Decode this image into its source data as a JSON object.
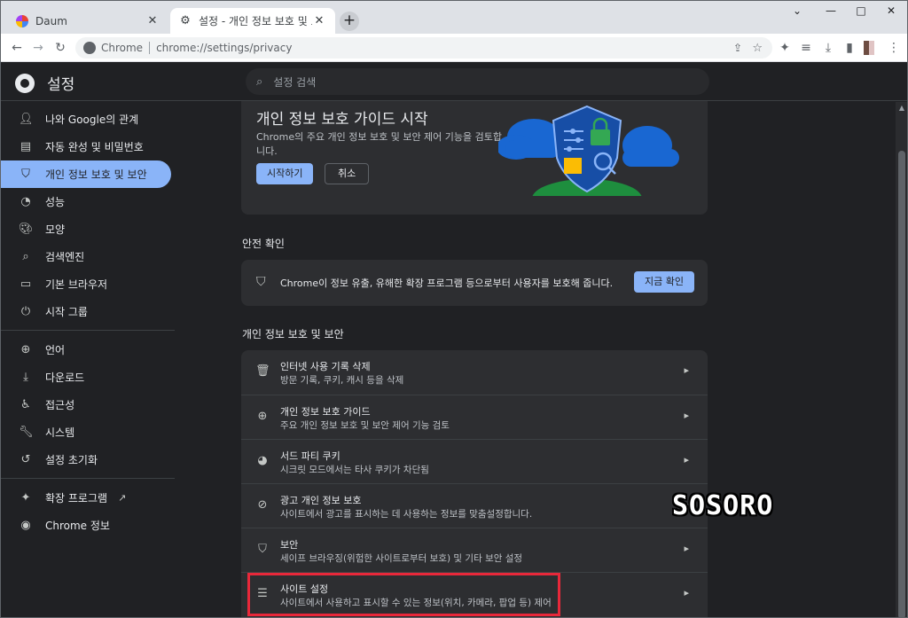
{
  "browser": {
    "tabs": [
      {
        "title": "Daum",
        "close": "✕"
      },
      {
        "title": "설정 - 개인 정보 보호 및 보안",
        "close": "✕"
      }
    ],
    "new_tab": "+",
    "window_controls": {
      "dropdown": "⌄",
      "minimize": "—",
      "maximize": "□",
      "close": "✕"
    },
    "omnibox": {
      "site_chip": "Chrome",
      "url": "chrome://settings/privacy"
    },
    "toolbar_icons": [
      "back-icon",
      "forward-icon",
      "reload-icon",
      "share-icon",
      "bookmark-star-icon",
      "extensions-icon",
      "reading-list-icon",
      "download-icon",
      "side-panel-icon",
      "profile-avatar",
      "more-menu-icon"
    ]
  },
  "settings": {
    "title": "설정",
    "search_placeholder": "설정 검색"
  },
  "sidebar": {
    "items": [
      {
        "label": "나와 Google의 관계",
        "icon": "person-icon"
      },
      {
        "label": "자동 완성 및 비밀번호",
        "icon": "clipboard-icon"
      },
      {
        "label": "개인 정보 보호 및 보안",
        "icon": "shield-icon",
        "active": true
      },
      {
        "label": "성능",
        "icon": "speedometer-icon"
      },
      {
        "label": "모양",
        "icon": "palette-icon"
      },
      {
        "label": "검색엔진",
        "icon": "search-icon"
      },
      {
        "label": "기본 브라우저",
        "icon": "browser-icon"
      },
      {
        "label": "시작 그룹",
        "icon": "power-icon"
      },
      {
        "label": "언어",
        "icon": "globe-icon"
      },
      {
        "label": "다운로드",
        "icon": "download-icon"
      },
      {
        "label": "접근성",
        "icon": "accessibility-icon"
      },
      {
        "label": "시스템",
        "icon": "wrench-icon"
      },
      {
        "label": "설정 초기화",
        "icon": "history-icon"
      },
      {
        "label": "확장 프로그램",
        "icon": "puzzle-icon"
      },
      {
        "label": "Chrome 정보",
        "icon": "chrome-icon"
      }
    ]
  },
  "promo": {
    "title": "개인 정보 보호 가이드 시작",
    "description": "Chrome의 주요 개인 정보 보호 및 보안 제어 기능을 검토합니다.",
    "start_button": "시작하기",
    "cancel_button": "취소"
  },
  "safety_check": {
    "section_title": "안전 확인",
    "text": "Chrome이 정보 유출, 유해한 확장 프로그램 등으로부터 사용자를 보호해 줍니다.",
    "button": "지금 확인"
  },
  "privacy": {
    "section_title": "개인 정보 보호 및 보안",
    "rows": [
      {
        "title": "인터넷 사용 기록 삭제",
        "subtitle": "방문 기록, 쿠키, 캐시 등을 삭제",
        "icon": "trash-icon"
      },
      {
        "title": "개인 정보 보호 가이드",
        "subtitle": "주요 개인 정보 보호 및 보안 제어 기능 검토",
        "icon": "add-circle-icon"
      },
      {
        "title": "서드 파티 쿠키",
        "subtitle": "시크릿 모드에서는 타사 쿠키가 차단됨",
        "icon": "cookie-icon"
      },
      {
        "title": "광고 개인 정보 보호",
        "subtitle": "사이트에서 광고를 표시하는 데 사용하는 정보를 맞춤설정합니다.",
        "icon": "ads-privacy-icon"
      },
      {
        "title": "보안",
        "subtitle": "세이프 브라우징(위험한 사이트로부터 보호) 및 기타 보안 설정",
        "icon": "security-shield-icon"
      },
      {
        "title": "사이트 설정",
        "subtitle": "사이트에서 사용하고 표시할 수 있는 정보(위치, 카메라, 팝업 등) 제어",
        "icon": "tune-icon"
      }
    ]
  },
  "watermark": "SOSORO",
  "colors": {
    "accent": "#8ab4f8",
    "highlight_box": "#e8283a",
    "background": "#202124",
    "card": "#2d2e31"
  }
}
